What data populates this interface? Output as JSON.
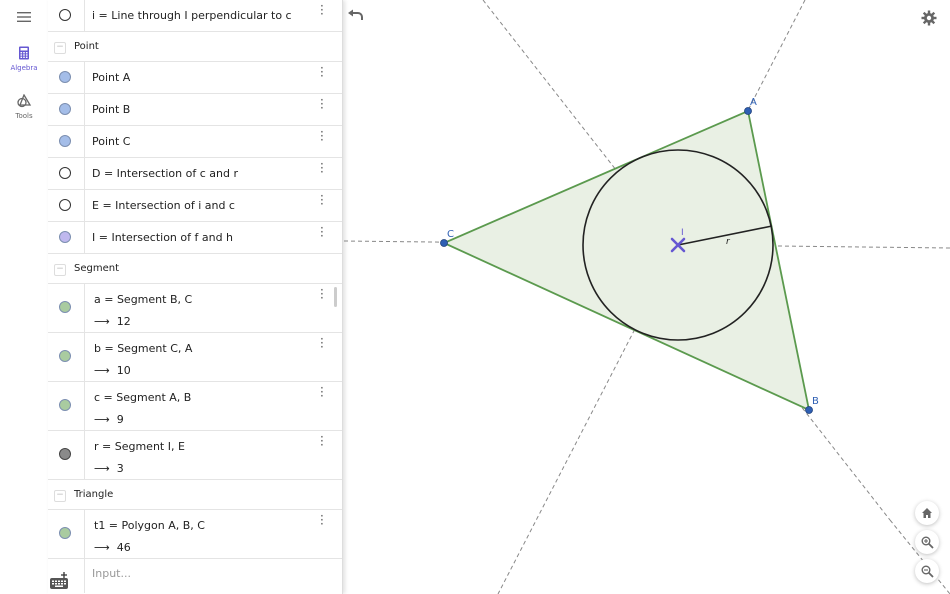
{
  "rail": {
    "menu_icon": "hamburger-menu-icon",
    "algebra_label": "Algebra",
    "tools_label": "Tools"
  },
  "algebra": {
    "items": [
      {
        "type": "row",
        "marble": "#ffffff",
        "text": "i = Line through I perpendicular to c"
      },
      {
        "type": "header",
        "text": "Point"
      },
      {
        "type": "row",
        "marble": "#a4bde8",
        "text": "Point A"
      },
      {
        "type": "row",
        "marble": "#a4bde8",
        "text": "Point B"
      },
      {
        "type": "row",
        "marble": "#a4bde8",
        "text": "Point C"
      },
      {
        "type": "row",
        "marble": "#ffffff",
        "text": "D = Intersection of c and r"
      },
      {
        "type": "row",
        "marble": "#ffffff",
        "text": "E = Intersection of i and c"
      },
      {
        "type": "row",
        "marble": "#bfb8ee",
        "text": "I = Intersection of f and h"
      },
      {
        "type": "header",
        "text": "Segment"
      },
      {
        "type": "row2",
        "marble": "#a9cba0",
        "text": "a = Segment B, C",
        "value": "12"
      },
      {
        "type": "row2",
        "marble": "#a9cba0",
        "text": "b = Segment C, A",
        "value": "10"
      },
      {
        "type": "row2",
        "marble": "#a9cba0",
        "text": "c = Segment A, B",
        "value": "9"
      },
      {
        "type": "row2",
        "marble": "#8a8a8a",
        "text": "r = Segment I, E",
        "value": "3"
      },
      {
        "type": "header",
        "text": "Triangle"
      },
      {
        "type": "row2",
        "marble": "#a9cba0",
        "text": "t1 = Polygon A, B, C",
        "value": "46"
      }
    ],
    "input_placeholder": "Input...",
    "arrow": "⟶"
  },
  "graphics": {
    "labels": {
      "A": "A",
      "B": "B",
      "C": "C",
      "I": "I",
      "r": "r"
    },
    "colors": {
      "triangle_stroke": "#5b9a4e",
      "triangle_fill": "#e9f0e4",
      "point": "#2e5fb3",
      "incenter": "#6557d2",
      "circle": "#222222",
      "dashed": "#888888"
    }
  },
  "toolbar": {
    "undo_icon": "undo-icon",
    "settings_icon": "gear-icon",
    "home_icon": "home-icon",
    "zoom_in_icon": "zoom-in-icon",
    "zoom_out_icon": "zoom-out-icon"
  }
}
